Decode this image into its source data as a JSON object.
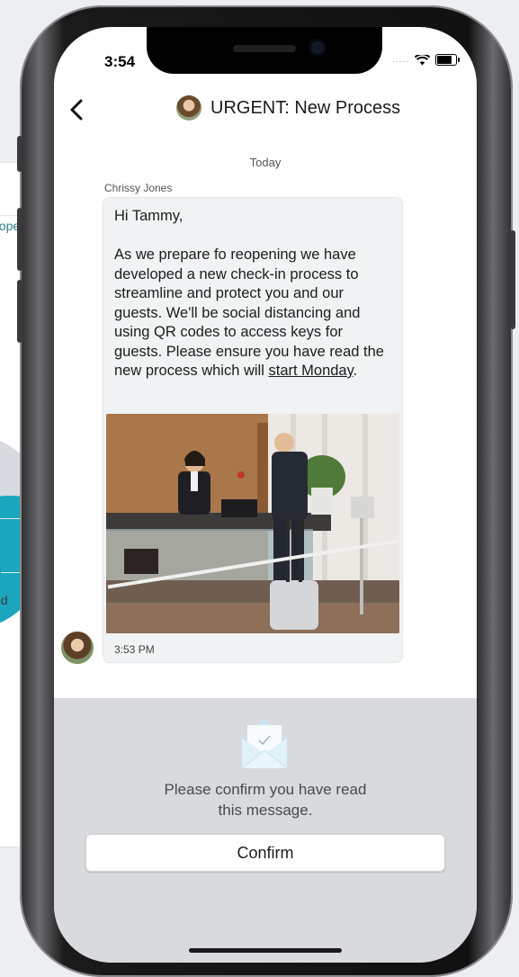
{
  "background": {
    "snippet_1": "nope",
    "snippet_2": "ied"
  },
  "status_bar": {
    "time": "3:54",
    "signal": "....."
  },
  "header": {
    "title": "URGENT: New Process"
  },
  "conversation": {
    "day_label": "Today",
    "sender": "Chrissy Jones",
    "message": {
      "text_main": "Hi Tammy,\n\nAs we prepare fo reopening we have developed a new check-in process to streamline and protect you and our guests. We'll be social distancing and using QR codes to access keys for guests. Please ensure you have read the new process which will ",
      "link_text": "start Monday",
      "text_end": ".",
      "time": "3:53 PM"
    }
  },
  "confirm_panel": {
    "prompt": "Please confirm you have read\nthis message.",
    "button_label": "Confirm"
  },
  "colors": {
    "accent_teal": "#1aa6bd",
    "panel_gray": "#d9dadd",
    "bubble_gray": "#f1f2f4"
  }
}
